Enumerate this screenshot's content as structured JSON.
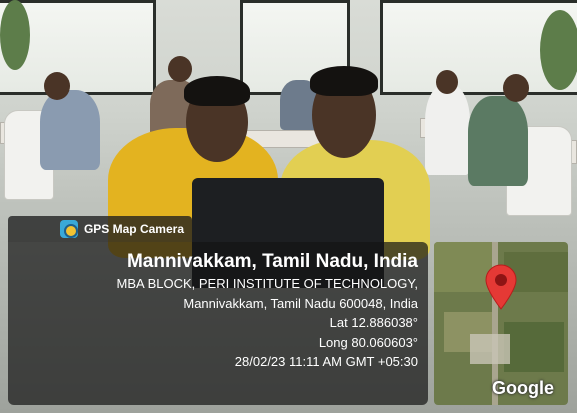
{
  "overlay": {
    "app_name": "GPS Map Camera",
    "place_title": "Mannivakkam, Tamil Nadu, India",
    "address_line1": "MBA BLOCK, PERI INSTITUTE OF TECHNOLOGY,",
    "address_line2": "Mannivakkam, Tamil Nadu 600048, India",
    "latitude": "Lat 12.886038°",
    "longitude": "Long 80.060603°",
    "timestamp": "28/02/23 11:11 AM GMT +05:30"
  },
  "map": {
    "logo_text": "Google",
    "pin_color": "#e53935"
  },
  "scene": {
    "description_icons": [
      "camera-icon",
      "map-pin-icon"
    ]
  }
}
